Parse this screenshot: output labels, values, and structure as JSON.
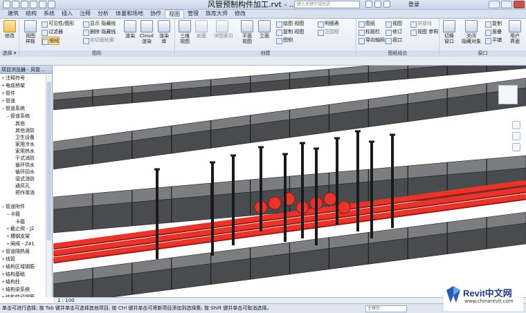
{
  "window": {
    "title": "风管预制构件加工.rvt - ...",
    "search_placeholder": "键入关键字或短语",
    "login": "登录"
  },
  "tabs": [
    "建筑",
    "结构",
    "系统",
    "插入",
    "注释",
    "分析",
    "体量和场地",
    "协作",
    "视图",
    "管理",
    "族库大师",
    "修改"
  ],
  "active_tab": "视图",
  "ribbon": {
    "select": {
      "big": "修改",
      "label": "选择 ▾"
    },
    "graphics": {
      "label": "图形",
      "big": [
        {
          "t": "视图\n样板"
        },
        {
          "t": "渲染"
        },
        {
          "t": "Cloud\n渲染"
        },
        {
          "t": "渲染\n库"
        }
      ],
      "small": [
        "可见性/图形",
        "过滤器",
        "细线",
        "显示 隐藏线",
        "删除 隐藏线",
        "剖切面轮廓"
      ]
    },
    "create": {
      "label": "创建",
      "big": [
        {
          "t": "三维\n视图"
        },
        {
          "t": "剖面"
        },
        {
          "t": "详图索引"
        },
        {
          "t": "平面\n视图"
        },
        {
          "t": "立面"
        }
      ],
      "small": [
        "绘图 视图",
        "复制 视图",
        "图例",
        "明细表",
        "范围框"
      ]
    },
    "sheet": {
      "label": "图纸组合",
      "small": [
        "图纸",
        "标题栏",
        "导向轴网",
        "视图",
        "修订",
        "拼接线",
        "视口",
        "视图 参照"
      ]
    },
    "windows": {
      "label": "窗口",
      "big": [
        {
          "t": "切换\n窗口"
        },
        {
          "t": "关闭\n隐藏对象"
        },
        {
          "t": "用户\n界面"
        }
      ],
      "small": [
        "复制",
        "层叠",
        "平铺"
      ]
    }
  },
  "browser": {
    "title": "项目浏览器 - 风管...",
    "items": [
      {
        "t": "注释符号",
        "d": 1,
        "e": "+"
      },
      {
        "t": "电缆桥架",
        "d": 1,
        "e": "+"
      },
      {
        "t": "管件",
        "d": 1,
        "e": "+"
      },
      {
        "t": "管道",
        "d": 1,
        "e": "+"
      },
      {
        "t": "管道系统",
        "d": 1,
        "e": "−"
      },
      {
        "t": "管道系统",
        "d": 2,
        "e": "−"
      },
      {
        "t": "其他",
        "d": 3,
        "e": ""
      },
      {
        "t": "其他消防",
        "d": 3,
        "e": ""
      },
      {
        "t": "卫生设备",
        "d": 3,
        "e": ""
      },
      {
        "t": "家用冷水",
        "d": 3,
        "e": ""
      },
      {
        "t": "家用热水",
        "d": 3,
        "e": ""
      },
      {
        "t": "干式消防",
        "d": 3,
        "e": ""
      },
      {
        "t": "循环供水",
        "d": 3,
        "e": ""
      },
      {
        "t": "循环回水",
        "d": 3,
        "e": ""
      },
      {
        "t": "湿式消防",
        "d": 3,
        "e": ""
      },
      {
        "t": "通风孔",
        "d": 3,
        "e": ""
      },
      {
        "t": "预作用消",
        "d": 3,
        "e": ""
      },
      {
        "t": "",
        "d": 3,
        "e": ""
      },
      {
        "t": "管道附件",
        "d": 1,
        "e": "−"
      },
      {
        "t": "卡箍",
        "d": 2,
        "e": "−"
      },
      {
        "t": "卡箍",
        "d": 3,
        "e": ""
      },
      {
        "t": "截止阀 - J2",
        "d": 2,
        "e": "+"
      },
      {
        "t": "槽钢支架",
        "d": 2,
        "e": "+"
      },
      {
        "t": "闸阀 - Z41",
        "d": 2,
        "e": "+"
      },
      {
        "t": "管道隔热层",
        "d": 1,
        "e": "+"
      },
      {
        "t": "线管",
        "d": 1,
        "e": "+"
      },
      {
        "t": "结构区域钢筋",
        "d": 1,
        "e": "+"
      },
      {
        "t": "结构基础",
        "d": 1,
        "e": "+"
      },
      {
        "t": "结构柱",
        "d": 1,
        "e": "+"
      },
      {
        "t": "结构梁系统",
        "d": 1,
        "e": "+"
      },
      {
        "t": "结构路径钢筋",
        "d": 1,
        "e": "+"
      },
      {
        "t": "详图项目",
        "d": 1,
        "e": "+"
      }
    ]
  },
  "view_scale": "1 : 100",
  "status_text": "单击可进行选择; 按 Tab 键并单击可选择其他项目; 按 Ctrl 键并单击可将新项目添加到选择集; 按 Shift 键并单击可取消选择。",
  "status_select": "主模型",
  "watermark": {
    "brand": "Revit中文网",
    "url": "www.chinarevit.com"
  },
  "colors": {
    "duct": "#4a4b4e",
    "duct_top": "#7b7d81",
    "pipe": "#e8342a",
    "accent": "#ffe19a"
  }
}
